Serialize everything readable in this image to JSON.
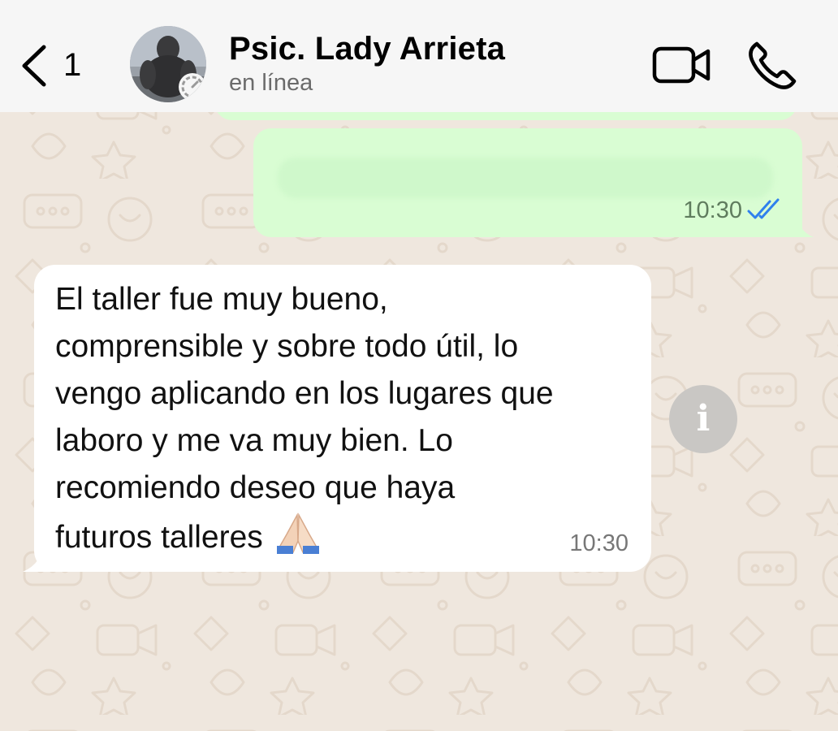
{
  "header": {
    "back_count": "1",
    "contact_name": "Psic. Lady Arrieta",
    "status": "en línea",
    "video_icon": "video-camera-icon",
    "call_icon": "phone-icon"
  },
  "messages": [
    {
      "direction": "outgoing",
      "text": "",
      "time": "10:30",
      "read_status": "double-check-read",
      "read_color": "#2f80ed"
    },
    {
      "direction": "incoming",
      "text": "El taller fue muy bueno,\ncomprensible y sobre todo útil,  lo\nvengo aplicando en los lugares que\nlaboro y me va muy bien. Lo\nrecomiendo deseo que haya\nfuturos talleres",
      "emoji": "🙏",
      "time": "10:30"
    }
  ],
  "colors": {
    "wallpaper": "#efe7de",
    "outgoing_bubble": "#d9fdd3",
    "incoming_bubble": "#ffffff",
    "header": "#f6f6f6"
  }
}
